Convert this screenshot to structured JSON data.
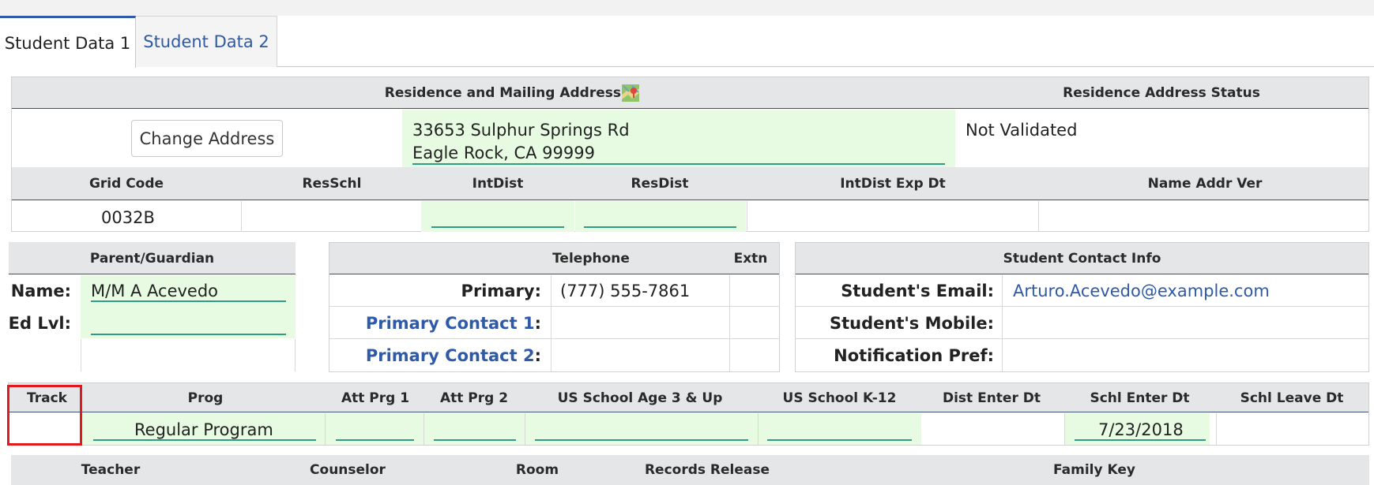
{
  "tabs": {
    "tab1": "Student Data 1",
    "tab2": "Student Data 2"
  },
  "address": {
    "header": "Residence and Mailing Address",
    "status_header": "Residence Address Status",
    "change_button": "Change Address",
    "line1": "33653 Sulphur Springs Rd",
    "line2": "Eagle Rock, CA 99999",
    "status": "Not Validated",
    "map_icon": "map-icon"
  },
  "grid": {
    "headers": [
      "Grid Code",
      "ResSchl",
      "IntDist",
      "ResDist",
      "IntDist Exp Dt",
      "Name Addr Ver"
    ],
    "grid_code": "0032B"
  },
  "parent": {
    "header": "Parent/Guardian",
    "name_label": "Name:",
    "name_value": "M/M A Acevedo",
    "edlvl_label": "Ed Lvl:"
  },
  "telephone": {
    "header": "Telephone",
    "extn_header": "Extn",
    "primary_label": "Primary",
    "primary_value": "(777) 555-7861",
    "contact1_label": "Primary Contact 1",
    "contact2_label": "Primary Contact 2",
    "colon": ":"
  },
  "contact": {
    "header": "Student Contact Info",
    "email_label": "Student's Email:",
    "email_value": "Arturo.Acevedo@example.com",
    "mobile_label": "Student's Mobile:",
    "notification_label": "Notification Pref:"
  },
  "program": {
    "headers": [
      "Track",
      "Prog",
      "Att Prg 1",
      "Att Prg 2",
      "US School Age 3 & Up",
      "US School K-12",
      "Dist Enter Dt",
      "Schl Enter Dt",
      "Schl Leave Dt"
    ],
    "prog_value": "Regular Program",
    "schl_enter_dt": "7/23/2018"
  },
  "bottom": {
    "headers": [
      "Teacher",
      "Counselor",
      "Room",
      "Records Release",
      "Family Key"
    ]
  }
}
